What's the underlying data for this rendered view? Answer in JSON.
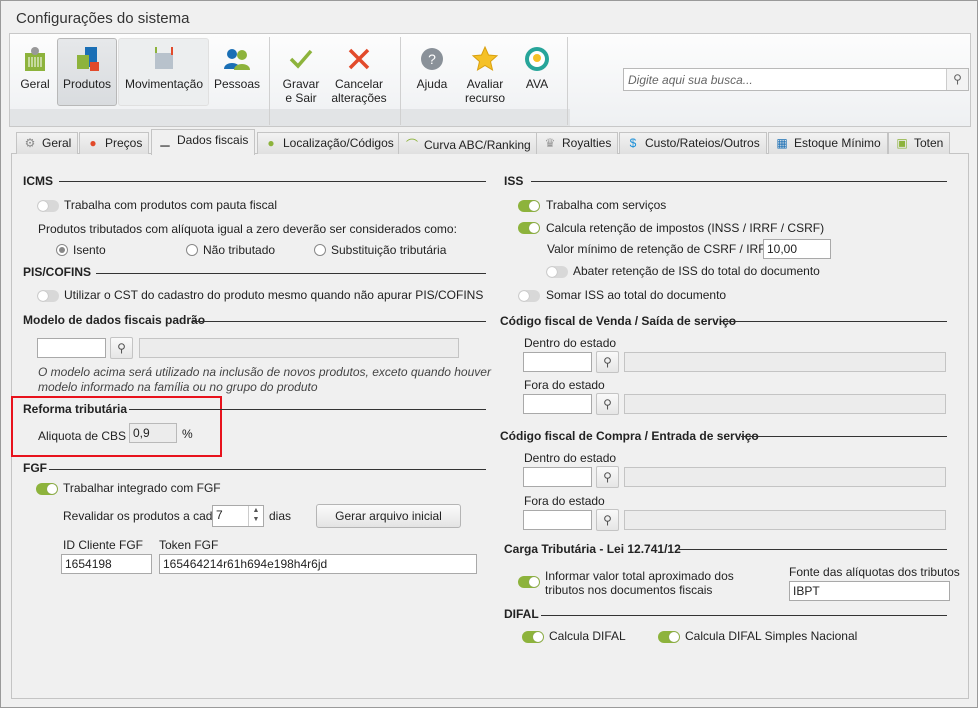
{
  "window": {
    "title": "Configurações do sistema"
  },
  "toolbar": {
    "buttons": [
      {
        "label": "Geral"
      },
      {
        "label": "Produtos"
      },
      {
        "label": "Movimentação"
      },
      {
        "label": "Pessoas"
      },
      {
        "label": "Gravar",
        "label2": "e Sair"
      },
      {
        "label": "Cancelar",
        "label2": "alterações"
      },
      {
        "label": "Ajuda"
      },
      {
        "label": "Avaliar",
        "label2": "recurso"
      },
      {
        "label": "AVA"
      }
    ],
    "search_placeholder": "Digite aqui sua busca..."
  },
  "tabs": [
    {
      "label": "Geral"
    },
    {
      "label": "Preços"
    },
    {
      "label": "Dados fiscais"
    },
    {
      "label": "Localização/Códigos"
    },
    {
      "label": "Curva ABC/Ranking"
    },
    {
      "label": "Royalties"
    },
    {
      "label": "Custo/Rateios/Outros"
    },
    {
      "label": "Estoque Mínimo"
    },
    {
      "label": "Toten"
    }
  ],
  "icms": {
    "title": "ICMS",
    "pauta": "Trabalha com produtos com pauta fiscal",
    "aliquota_zero": "Produtos tributados com alíquota igual a zero deverão ser considerados como:",
    "options": [
      "Isento",
      "Não tributado",
      "Substituição tributária"
    ]
  },
  "pis": {
    "title": "PIS/COFINS",
    "cst": "Utilizar o CST do cadastro do produto mesmo quando não apurar PIS/COFINS"
  },
  "modelo": {
    "title": "Modelo de dados fiscais padrão",
    "note1": "O modelo acima será utilizado na inclusão de novos produtos, exceto quando houver",
    "note2": "modelo informado na família ou no grupo do produto"
  },
  "reforma": {
    "title": "Reforma tributária",
    "label": "Aliquota de CBS",
    "value": "0,9",
    "unit": "%"
  },
  "fgf": {
    "title": "FGF",
    "integrado": "Trabalhar integrado com FGF",
    "revalidar": "Revalidar os produtos a cada",
    "dias_value": "7",
    "dias": "dias",
    "gerar": "Gerar arquivo inicial",
    "id_label": "ID Cliente FGF",
    "id_value": "1654198",
    "token_label": "Token FGF",
    "token_value": "165464214r61h694e198h4r6jd"
  },
  "iss": {
    "title": "ISS",
    "servicos": "Trabalha com serviços",
    "retencao": "Calcula retenção de impostos (INSS / IRRF / CSRF)",
    "valor_min_label": "Valor mínimo de retenção de CSRF / IRRF",
    "valor_min": "10,00",
    "abater": "Abater retenção de ISS do total do documento",
    "somar": "Somar ISS ao total do documento"
  },
  "venda": {
    "title": "Código fiscal de Venda / Saída de serviço",
    "dentro": "Dentro do estado",
    "fora": "Fora do estado"
  },
  "compra": {
    "title": "Código fiscal de Compra / Entrada de serviço",
    "dentro": "Dentro do estado",
    "fora": "Fora do estado"
  },
  "carga": {
    "title": "Carga Tributária - Lei 12.741/12",
    "informar1": "Informar valor total aproximado dos",
    "informar2": "tributos nos documentos fiscais",
    "fonte_label": "Fonte das alíquotas dos tributos",
    "fonte_value": "IBPT"
  },
  "difal": {
    "title": "DIFAL",
    "calcula": "Calcula DIFAL",
    "simples": "Calcula DIFAL Simples Nacional"
  }
}
